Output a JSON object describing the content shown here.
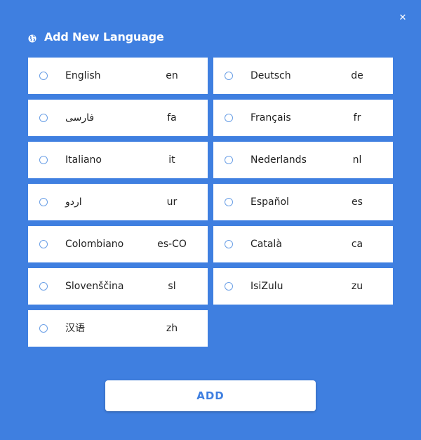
{
  "dialog": {
    "title": "Add New Language",
    "title_icon": "globe-icon",
    "close_icon": "close-icon",
    "close_glyph": "✕",
    "add_label": "ADD",
    "accent_color": "#3f7fe0"
  },
  "languages": [
    {
      "name": "English",
      "code": "en",
      "selected": false
    },
    {
      "name": "Deutsch",
      "code": "de",
      "selected": false
    },
    {
      "name": "فارسی",
      "code": "fa",
      "selected": false
    },
    {
      "name": "Français",
      "code": "fr",
      "selected": false
    },
    {
      "name": "Italiano",
      "code": "it",
      "selected": false
    },
    {
      "name": "Nederlands",
      "code": "nl",
      "selected": false
    },
    {
      "name": "اردو",
      "code": "ur",
      "selected": false
    },
    {
      "name": "Español",
      "code": "es",
      "selected": false
    },
    {
      "name": "Colombiano",
      "code": "es-CO",
      "selected": false
    },
    {
      "name": "Català",
      "code": "ca",
      "selected": false
    },
    {
      "name": "Slovenščina",
      "code": "sl",
      "selected": false
    },
    {
      "name": "IsiZulu",
      "code": "zu",
      "selected": false
    },
    {
      "name": "汉语",
      "code": "zh",
      "selected": false
    }
  ]
}
